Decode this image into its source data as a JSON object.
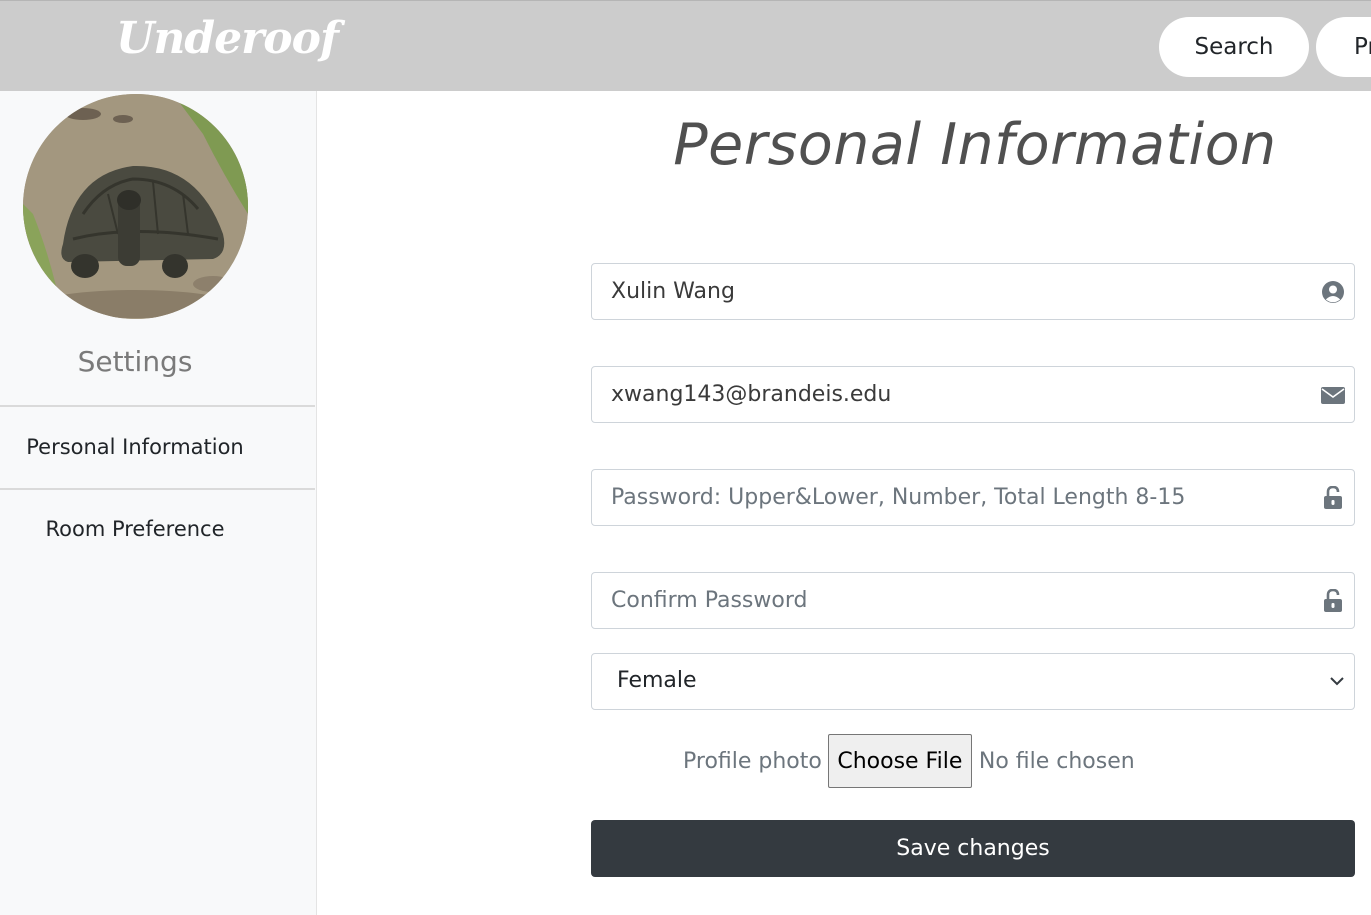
{
  "brand": {
    "logo_text": "Underoof"
  },
  "nav": {
    "search_label": "Search",
    "profile_label": "Pr"
  },
  "sidebar": {
    "settings_title": "Settings",
    "items": [
      {
        "label": "Personal Information"
      },
      {
        "label": "Room Preference"
      }
    ]
  },
  "main": {
    "title": "Personal Information",
    "fields": {
      "name": {
        "value": "Xulin Wang",
        "icon": "user-circle-icon"
      },
      "email": {
        "value": "xwang143@brandeis.edu",
        "icon": "envelope-icon"
      },
      "password": {
        "value": "",
        "placeholder": "Password: Upper&Lower, Number, Total Length 8-15",
        "icon": "unlock-icon"
      },
      "confirm_password": {
        "value": "",
        "placeholder": "Confirm Password",
        "icon": "unlock-icon"
      }
    },
    "gender": {
      "selected": "Female"
    },
    "profile_photo": {
      "label": "Profile photo",
      "button_label": "Choose File",
      "status": "No file chosen"
    },
    "save_label": "Save changes"
  },
  "colors": {
    "topbar": "#cccccc",
    "sidebar": "#f8f9fa",
    "save_button": "#343a40"
  }
}
